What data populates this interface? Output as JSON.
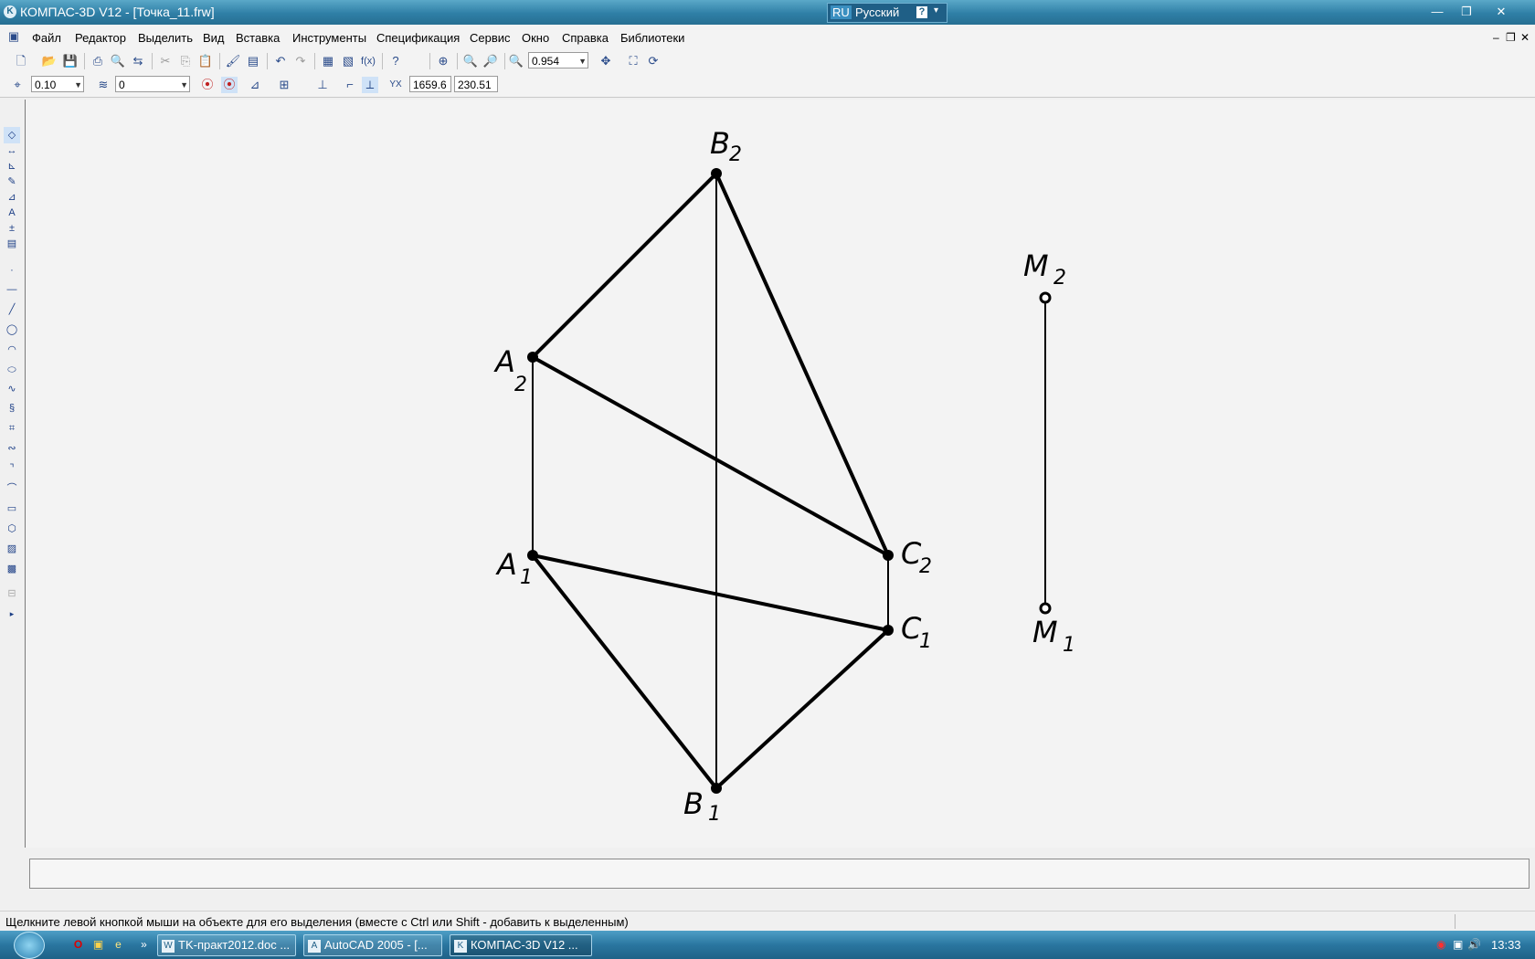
{
  "window": {
    "title": "КОМПАС-3D V12 - [Точка_11.frw]",
    "language_code": "RU",
    "language_name": "Русский",
    "help_glyph": "?",
    "minimize_glyph": "—",
    "restore_glyph": "❐",
    "close_glyph": "✕"
  },
  "menu": {
    "items": [
      "Файл",
      "Редактор",
      "Выделить",
      "Вид",
      "Вставка",
      "Инструменты",
      "Спецификация",
      "Сервис",
      "Окно",
      "Справка",
      "Библиотеки"
    ],
    "doc_minimize": "–",
    "doc_restore": "❐",
    "doc_close": "✕"
  },
  "toolbar": {
    "zoom_value": "0.954",
    "step_value": "0.10",
    "layer_value": "0",
    "coord_x": "1659.6",
    "coord_y": "230.51"
  },
  "drawing": {
    "labels": {
      "b2_main": "B",
      "b2_sub": "2",
      "a2_main": "A",
      "a2_sub": "2",
      "a1_main": "A",
      "a1_sub": "1",
      "c2_main": "C",
      "c2_sub": "2",
      "c1_main": "C",
      "c1_sub": "1",
      "b1_main": "B",
      "b1_sub": "1",
      "m2_main": "M",
      "m2_sub": "2",
      "m1_main": "M",
      "m1_sub": "1"
    }
  },
  "status": {
    "text": "Щелкните левой кнопкой мыши на объекте для его выделения (вместе с Ctrl или Shift - добавить к выделенным)"
  },
  "taskbar": {
    "tasks": [
      "TK-практ2012.doc ...",
      "AutoCAD 2005 - [...",
      "КОМПАС-3D V12 ..."
    ],
    "time": "13:33"
  }
}
